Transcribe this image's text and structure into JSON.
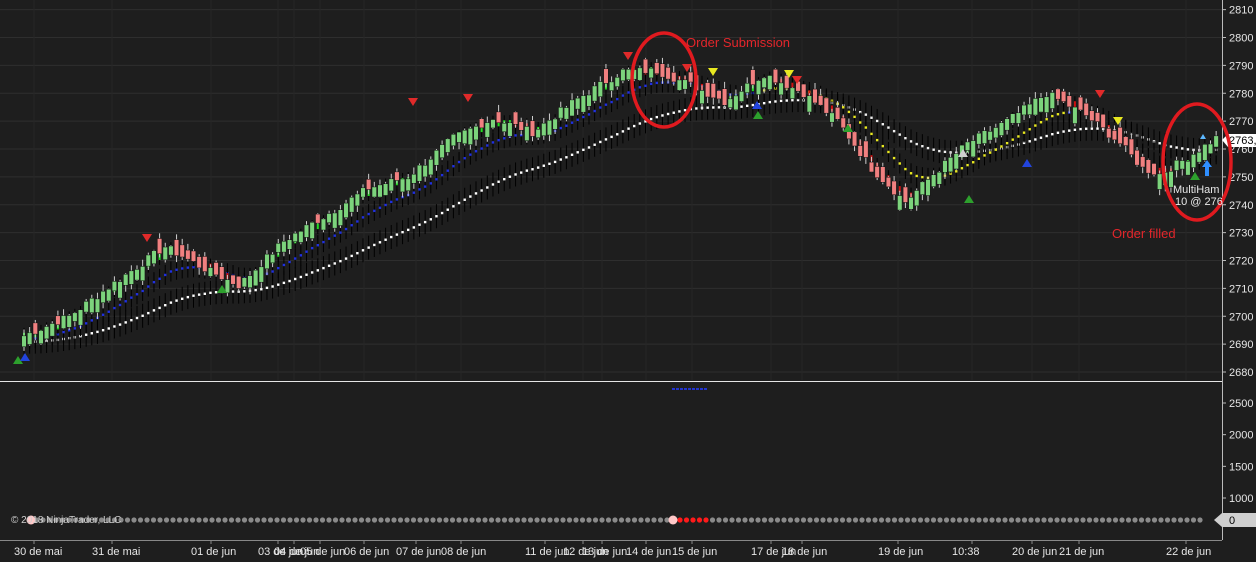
{
  "app": {
    "copyright": "© 2018 NinjaTrader, LLC",
    "price_badge": "2763,",
    "volume_badge": "0"
  },
  "annotations": {
    "order_submission": "Order Submission",
    "order_filled": "Order filled",
    "order_label_line1": "MultiHam",
    "order_label_line2": "10 @ 276"
  },
  "colors": {
    "background": "#1e1e1e",
    "up_candle": "#7cd37c",
    "down_candle": "#f08080",
    "circle": "#e01a1f",
    "fast_ma_up": "#20e020",
    "fast_ma_down": "#d01010",
    "mid_ma": "#2030e0",
    "slow_ma": "#ffffff",
    "yellow_ma": "#e8e820"
  },
  "chart_data": {
    "type": "candlestick",
    "price_axis": {
      "ticks": [
        2680,
        2690,
        2700,
        2710,
        2720,
        2730,
        2740,
        2750,
        2760,
        2770,
        2780,
        2790,
        2800,
        2810
      ],
      "ylim": [
        2677,
        2813
      ]
    },
    "volume_axis": {
      "ticks": [
        1000,
        1500,
        2000,
        2500
      ]
    },
    "date_labels": [
      "30 de mai",
      "31 de mai",
      "01 de jun",
      "03 de jun",
      "04 de jun",
      "05 de jun",
      "06 de jun",
      "07 de jun",
      "08 de jun",
      "11 de jun",
      "12 de jun",
      "13 de jun",
      "14 de jun",
      "15 de jun",
      "17 de jun",
      "18 de jun",
      "19 de jun",
      "10:38",
      "20 de jun",
      "21 de jun",
      "22 de jun"
    ],
    "price_path": [
      [
        0,
        2693
      ],
      [
        8,
        2700
      ],
      [
        16,
        2712
      ],
      [
        25,
        2725
      ],
      [
        31,
        2718
      ],
      [
        38,
        2711
      ],
      [
        46,
        2727
      ],
      [
        54,
        2737
      ],
      [
        61,
        2746
      ],
      [
        68,
        2750
      ],
      [
        76,
        2764
      ],
      [
        83,
        2771
      ],
      [
        90,
        2766
      ],
      [
        98,
        2778
      ],
      [
        106,
        2788
      ],
      [
        112,
        2788
      ],
      [
        118,
        2783
      ],
      [
        124,
        2777
      ],
      [
        131,
        2787
      ],
      [
        138,
        2780
      ],
      [
        144,
        2770
      ],
      [
        150,
        2753
      ],
      [
        156,
        2741
      ],
      [
        161,
        2751
      ],
      [
        167,
        2762
      ],
      [
        174,
        2770
      ],
      [
        181,
        2780
      ],
      [
        188,
        2772
      ],
      [
        194,
        2762
      ],
      [
        198,
        2753
      ],
      [
        201,
        2751
      ],
      [
        206,
        2757
      ],
      [
        211,
        2764
      ]
    ]
  }
}
